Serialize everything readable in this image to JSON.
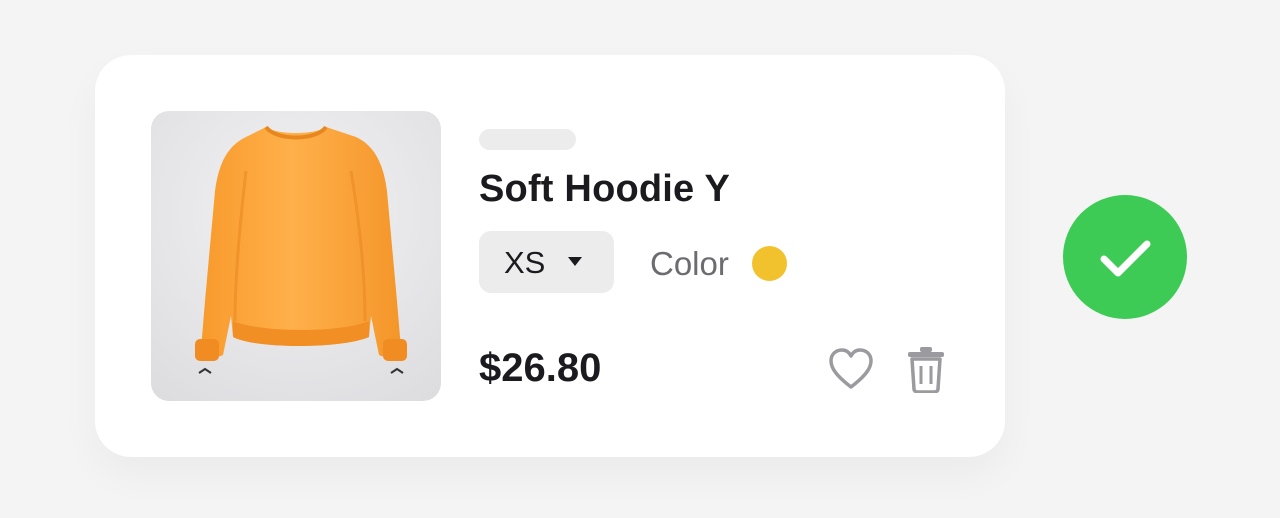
{
  "product": {
    "name": "Soft Hoodie Y",
    "size": "XS",
    "color_label": "Color",
    "color_value": "#f2c12e",
    "price": "$26.80",
    "image": "orange-sweatshirt"
  },
  "actions": {
    "favorite_icon": "heart-icon",
    "delete_icon": "trash-icon",
    "confirm_icon": "checkmark-icon"
  },
  "colors": {
    "confirm": "#3ecb55",
    "product": "#fda73d"
  }
}
